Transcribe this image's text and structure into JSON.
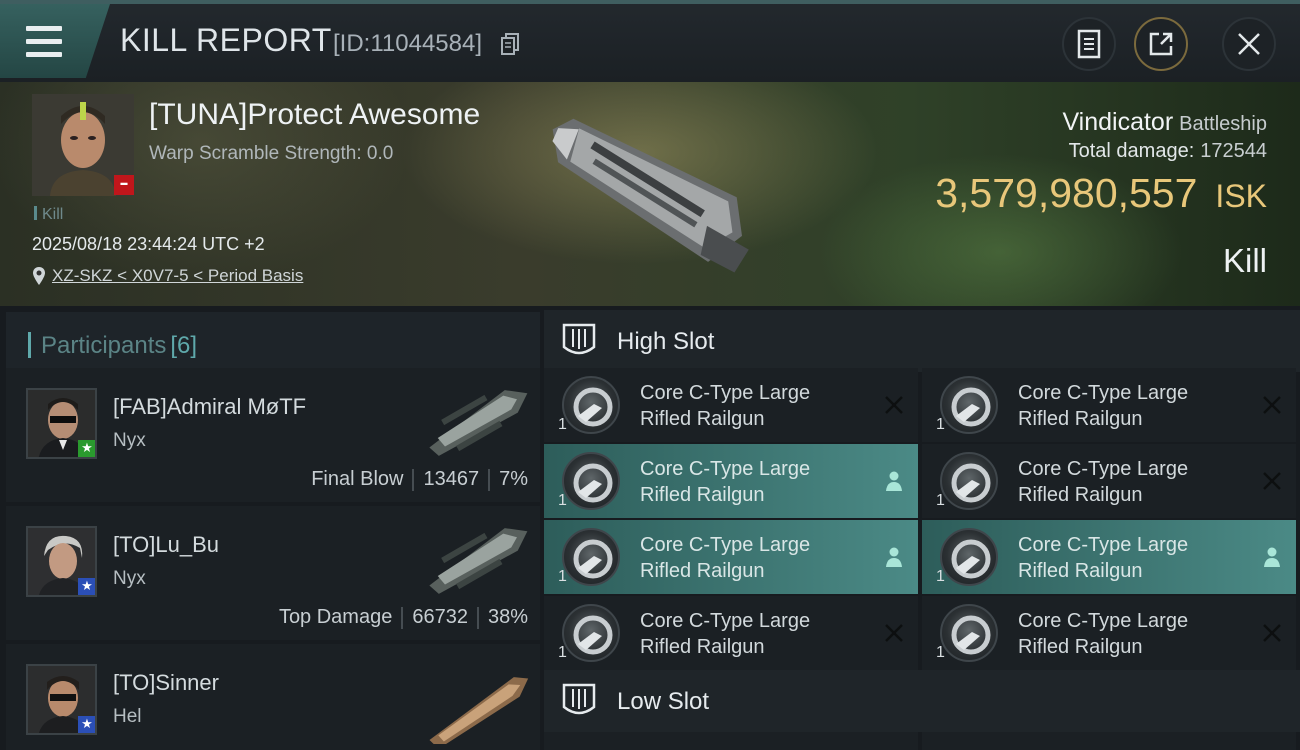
{
  "header": {
    "title": "KILL REPORT",
    "report_id": "[ID:11044584]",
    "buttons": [
      "clipboard-icon",
      "share-icon",
      "close-icon"
    ]
  },
  "victim": {
    "name": "[TUNA]Protect Awesome",
    "warp_scramble": "Warp Scramble Strength: 0.0",
    "tag": "Kill",
    "time": "2025/08/18 23:44:24 UTC +2",
    "location": "XZ-SKZ < X0V7-5 < Period Basis",
    "ship_name": "Vindicator",
    "ship_class": "Battleship",
    "total_damage_label": "Total damage:",
    "total_damage": "172544",
    "isk_value": "3,579,980,557",
    "isk_unit": "ISK",
    "result": "Kill"
  },
  "participants": {
    "title": "Participants",
    "count": "[6]",
    "rows": [
      {
        "name": "[FAB]Admiral MøTF",
        "ship": "Nyx",
        "role": "Final Blow",
        "damage": "13467",
        "percent": "7%",
        "badge_color": "#2a9a2e",
        "badge_icon": "star-icon"
      },
      {
        "name": "[TO]Lu_Bu",
        "ship": "Nyx",
        "role": "Top Damage",
        "damage": "66732",
        "percent": "38%",
        "badge_color": "#2b4fb7",
        "badge_icon": "star-icon"
      },
      {
        "name": "[TO]Sinner",
        "ship": "Hel",
        "role": "",
        "damage": "",
        "percent": "",
        "badge_color": "#2b4fb7",
        "badge_icon": "star-icon"
      }
    ]
  },
  "slots": {
    "high_title": "High Slot",
    "low_title": "Low Slot",
    "items": [
      {
        "name_line1": "Core C-Type Large",
        "name_line2": "Rifled Railgun",
        "qty": "1",
        "state": "destroyed"
      },
      {
        "name_line1": "Core C-Type Large",
        "name_line2": "Rifled Railgun",
        "qty": "1",
        "state": "destroyed"
      },
      {
        "name_line1": "Core C-Type Large",
        "name_line2": "Rifled Railgun",
        "qty": "1",
        "state": "dropped"
      },
      {
        "name_line1": "Core C-Type Large",
        "name_line2": "Rifled Railgun",
        "qty": "1",
        "state": "destroyed"
      },
      {
        "name_line1": "Core C-Type Large",
        "name_line2": "Rifled Railgun",
        "qty": "1",
        "state": "dropped"
      },
      {
        "name_line1": "Core C-Type Large",
        "name_line2": "Rifled Railgun",
        "qty": "1",
        "state": "dropped"
      },
      {
        "name_line1": "Core C-Type Large",
        "name_line2": "Rifled Railgun",
        "qty": "1",
        "state": "destroyed"
      },
      {
        "name_line1": "Core C-Type Large",
        "name_line2": "Rifled Railgun",
        "qty": "1",
        "state": "destroyed"
      }
    ]
  },
  "colors": {
    "accent_teal": "#5fa9ab",
    "isk_gold": "#e8c77a",
    "dropped_green": "#4b8a86",
    "victim_badge_red": "#c0161b"
  }
}
